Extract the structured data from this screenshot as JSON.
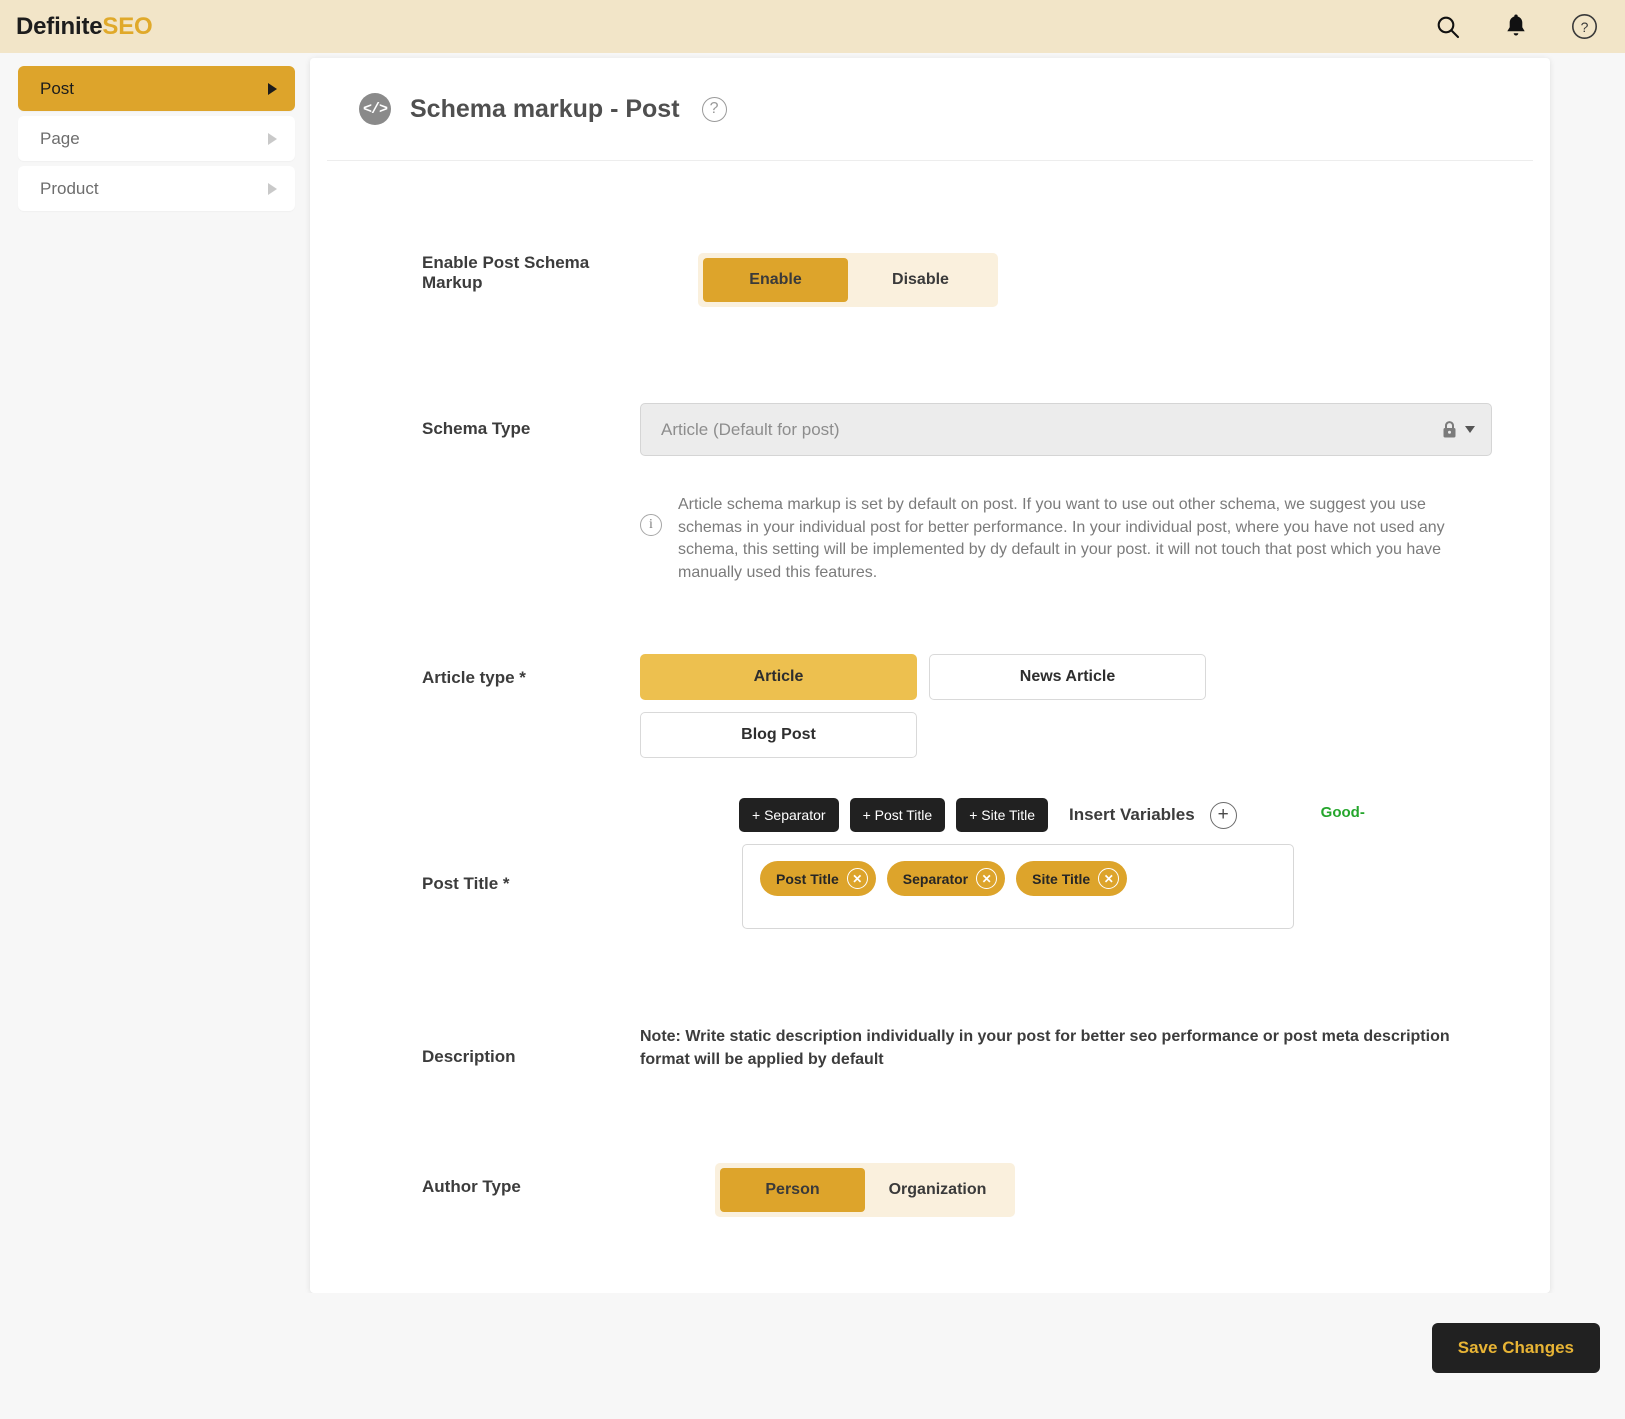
{
  "brand": {
    "part1": "Definite",
    "part2": "SEO"
  },
  "topbar": {
    "icons": [
      {
        "name": "search-icon",
        "label": "Search"
      },
      {
        "name": "notification-bell-icon",
        "label": "Notifications"
      },
      {
        "name": "help-circle-icon",
        "label": "Help"
      }
    ]
  },
  "sidebar": {
    "items": [
      {
        "label": "Post",
        "active": true
      },
      {
        "label": "Page",
        "active": false
      },
      {
        "label": "Product",
        "active": false
      }
    ]
  },
  "card": {
    "title": "Schema markup - Post",
    "badge_icon": "</>",
    "help_glyph": "?"
  },
  "enable_schema": {
    "label": "Enable Post Schema Markup",
    "options": [
      {
        "label": "Enable",
        "selected": true
      },
      {
        "label": "Disable",
        "selected": false
      }
    ]
  },
  "schema_type": {
    "label": "Schema Type",
    "value": "Article (Default for post)",
    "locked": true,
    "lock_icon": "lock-icon",
    "dropdown_icon": "chevron-down-icon",
    "info_icon": "info-circle-icon",
    "info_text": "Article schema markup is set by default on post. If you want to use out other schema, we suggest you use schemas in your individual post for better performance. In your individual post, where you have not used any schema, this setting will be implemented by dy default in your post. it will not touch that post which you have manually used this features."
  },
  "article_type": {
    "label": "Article type *",
    "options": [
      {
        "label": "Article",
        "selected": true
      },
      {
        "label": "News Article",
        "selected": false
      },
      {
        "label": "Blog Post",
        "selected": false
      }
    ]
  },
  "variables": {
    "chips": [
      {
        "label": "+ Separator"
      },
      {
        "label": "+ Post Title"
      },
      {
        "label": "+ Site Title"
      }
    ],
    "insert_label": "Insert Variables",
    "add_icon": "plus-circle-icon",
    "quality_badge": "Good-",
    "quality_color": "#25a62c"
  },
  "post_title": {
    "label": "Post Title *",
    "tokens": [
      {
        "label": "Post Title",
        "remove_icon": "close-icon"
      },
      {
        "label": "Separator",
        "remove_icon": "close-icon"
      },
      {
        "label": "Site Title",
        "remove_icon": "close-icon"
      }
    ]
  },
  "description": {
    "label": "Description",
    "note": "Note: Write static description individually in your post for better seo performance or post meta description format will be applied by default"
  },
  "author_type": {
    "label": "Author Type",
    "options": [
      {
        "label": "Person",
        "selected": true
      },
      {
        "label": "Organization",
        "selected": false
      }
    ]
  },
  "footer": {
    "save_label": "Save Changes"
  },
  "colors": {
    "accent": "#dda42b",
    "accent_light": "#edc04f",
    "header_bg": "#f2e5c8",
    "seg_track": "#faf0dd",
    "dark": "#212121",
    "success": "#25a62c"
  }
}
